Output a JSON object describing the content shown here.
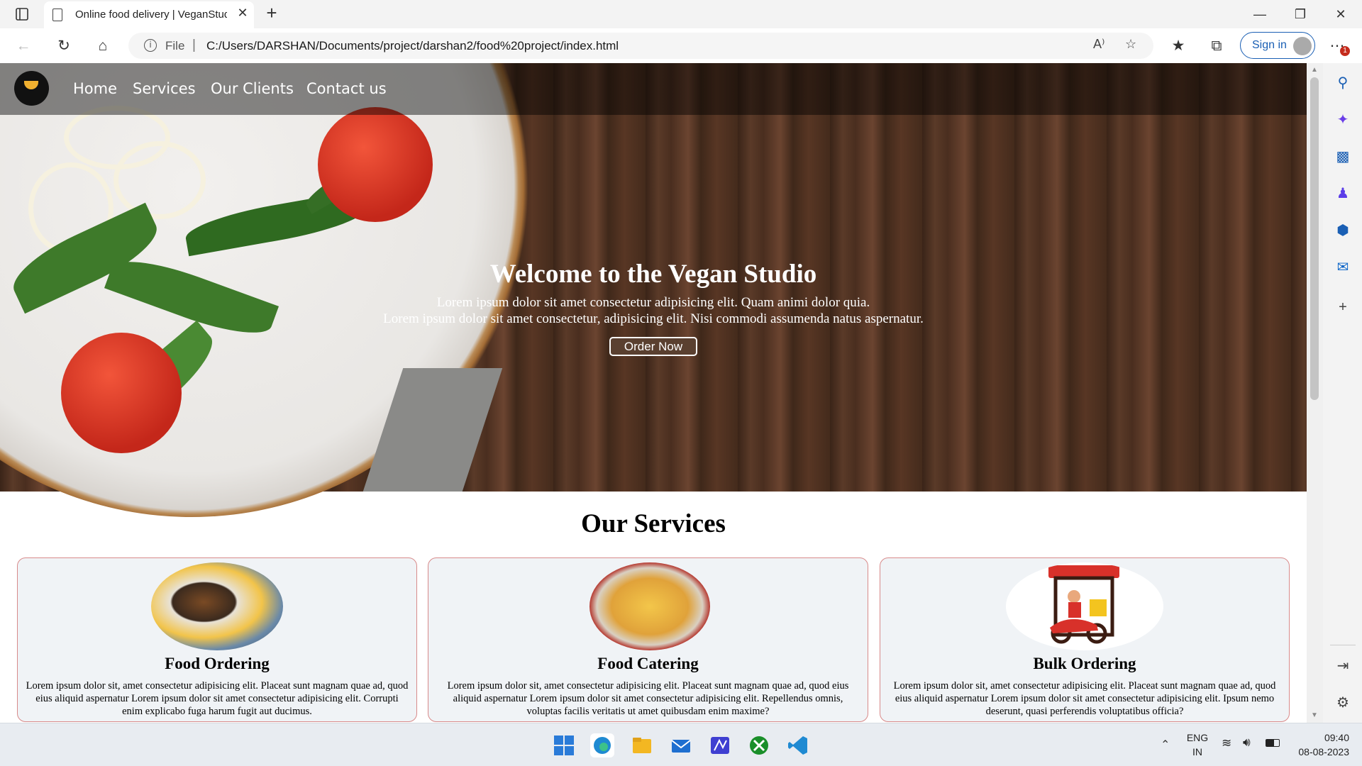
{
  "browser": {
    "tab_title": "Online food delivery | VeganStudio",
    "new_tab_symbol": "+",
    "close_symbol": "✕",
    "address_scheme": "File",
    "address_url": "C:/Users/DARSHAN/Documents/project/darshan2/food%20project/index.html",
    "signin_label": "Sign in",
    "notification_badge": "1"
  },
  "site": {
    "nav": [
      "Home",
      "Services",
      "Our Clients",
      "Contact us"
    ],
    "hero": {
      "title": "Welcome to the Vegan Studio",
      "line1": "Lorem ipsum dolor sit amet consectetur adipisicing elit. Quam animi dolor quia.",
      "line2": "Lorem ipsum dolor sit amet consectetur, adipisicing elit. Nisi commodi assumenda natus aspernatur.",
      "button": "Order Now"
    },
    "services_title": "Our Services",
    "services": [
      {
        "title": "Food Ordering",
        "text": "Lorem ipsum dolor sit, amet consectetur adipisicing elit. Placeat sunt magnam quae ad, quod eius aliquid aspernatur Lorem ipsum dolor sit amet consectetur adipisicing elit. Corrupti enim explicabo fuga harum fugit aut ducimus."
      },
      {
        "title": "Food Catering",
        "text": "Lorem ipsum dolor sit, amet consectetur adipisicing elit. Placeat sunt magnam quae ad, quod eius aliquid aspernatur Lorem ipsum dolor sit amet consectetur adipisicing elit. Repellendus omnis, voluptas facilis veritatis ut amet quibusdam enim maxime?"
      },
      {
        "title": "Bulk Ordering",
        "text": "Lorem ipsum dolor sit, amet consectetur adipisicing elit. Placeat sunt magnam quae ad, quod eius aliquid aspernatur Lorem ipsum dolor sit amet consectetur adipisicing elit. Ipsum nemo deserunt, quasi perferendis voluptatibus officia?"
      }
    ]
  },
  "taskbar": {
    "lang_line1": "ENG",
    "lang_line2": "IN",
    "time": "09:40",
    "date": "08-08-2023"
  },
  "colors": {
    "accent": "#1a5fb4",
    "card_border": "#d88a8a",
    "card_bg": "#f0f3f6"
  }
}
